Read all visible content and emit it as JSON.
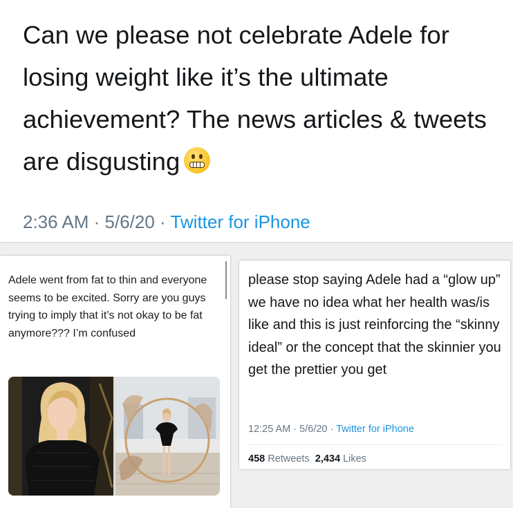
{
  "top_tweet": {
    "text": "Can we please not celebrate Adele for losing weight like it’s the ultimate achievement? The news articles & tweets are disgusting",
    "emoji": "grimacing-face-emoji",
    "time": "2:36 AM",
    "date": "5/6/20",
    "source": "Twitter for iPhone"
  },
  "left_post": {
    "text": "Adele went from fat to thin and everyone seems to be excited. Sorry are you guys trying to imply that it’s not okay to be fat anymore??? I’m confused",
    "image_left": "photo-adele-before",
    "image_right": "photo-adele-after"
  },
  "right_tweet": {
    "text": "please stop saying Adele had a “glow up” we have no idea what her health was/is like and this is just reinforcing the “skinny ideal” or the concept that the skinnier you get the prettier you get",
    "time": "12:25 AM",
    "date": "5/6/20",
    "source": "Twitter for iPhone",
    "retweets_count": "458",
    "retweets_label": "Retweets",
    "likes_count": "2,434",
    "likes_label": "Likes"
  },
  "colors": {
    "link": "#1b95e0",
    "meta_gray": "#657786",
    "text": "#14171a"
  }
}
